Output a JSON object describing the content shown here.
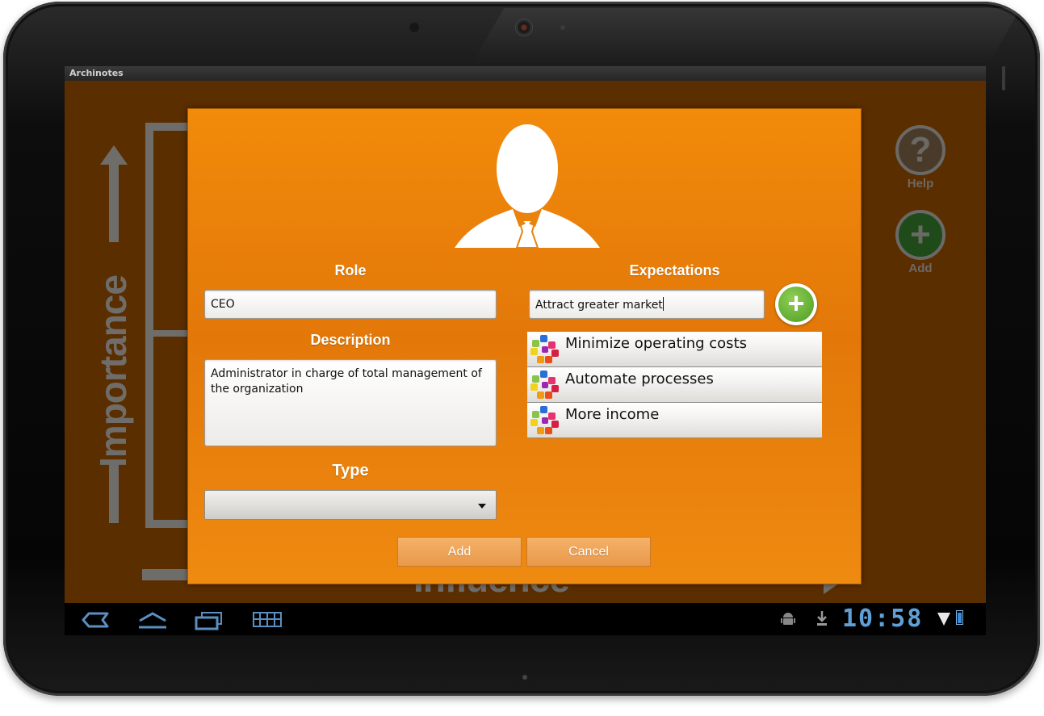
{
  "app": {
    "title": "Archinotes"
  },
  "background": {
    "vertical_axis_label": "Importance",
    "horizontal_axis_label": "Influence",
    "help_button": {
      "glyph": "?",
      "label": "Help"
    },
    "add_button": {
      "glyph": "+",
      "label": "Add"
    }
  },
  "dialog": {
    "avatar_icon": "person-silhouette-icon",
    "role": {
      "title": "Role",
      "value": "CEO"
    },
    "description": {
      "title": "Description",
      "value": "Administrator in charge of total management of the organization"
    },
    "type": {
      "title": "Type",
      "selected": ""
    },
    "expectations": {
      "title": "Expectations",
      "input_value": "Attract greater market",
      "add_glyph": "+",
      "items": [
        {
          "label": "Minimize operating costs"
        },
        {
          "label": "Automate processes"
        },
        {
          "label": "More income"
        }
      ]
    },
    "buttons": {
      "add": "Add",
      "cancel": "Cancel"
    }
  },
  "status_bar": {
    "time": "10:58"
  },
  "colors": {
    "dialog_orange": "#f28a0a",
    "app_background": "#5b2e00",
    "add_green": "#5aa82b",
    "clock_blue": "#5fa0d8"
  }
}
